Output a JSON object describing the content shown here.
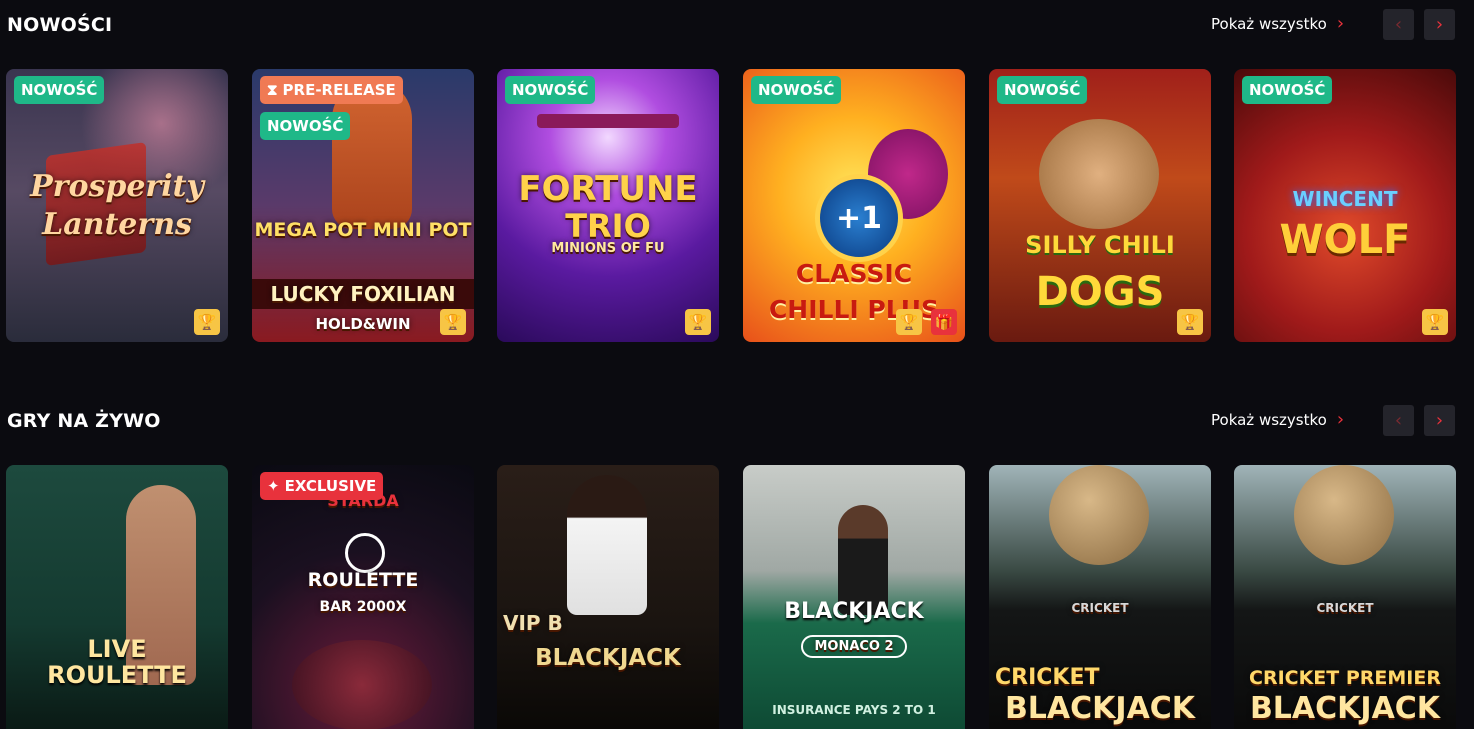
{
  "sections": [
    {
      "title": "NOWOŚCI",
      "show_all": "Pokaż wszystko",
      "tiles": [
        {
          "name": "Prosperity Lanterns",
          "art_lines": [
            "Prosperity",
            "Lanterns"
          ],
          "badges": [
            "NOWOŚĆ"
          ]
        },
        {
          "name": "Lucky Foxilian",
          "art_lines": [
            "MEGA POT   MINI POT",
            "LUCKY FOXILIAN",
            "HOLD&WIN"
          ],
          "badges": [
            "PRE-RELEASE",
            "NOWOŚĆ"
          ]
        },
        {
          "name": "Fortune Trio",
          "art_lines": [
            "FORTUNE",
            "TRIO",
            "MINIONS OF FU"
          ],
          "badges": [
            "NOWOŚĆ"
          ]
        },
        {
          "name": "Classic Chilli Plus",
          "art_lines": [
            "+1",
            "CLASSIC",
            "CHILLI PLUS"
          ],
          "badges": [
            "NOWOŚĆ"
          ]
        },
        {
          "name": "Silly Chili Dogs",
          "art_lines": [
            "SILLY CHILI",
            "DOGS"
          ],
          "badges": [
            "NOWOŚĆ"
          ]
        },
        {
          "name": "Wincent Wolf",
          "art_lines": [
            "WINCENT",
            "WOLF"
          ],
          "badges": [
            "NOWOŚĆ"
          ]
        }
      ]
    },
    {
      "title": "GRY NA ŻYWO",
      "show_all": "Pokaż wszystko",
      "tiles": [
        {
          "name": "Live Roulette",
          "art_lines": [
            "LIVE",
            "ROULETTE"
          ],
          "badges": []
        },
        {
          "name": "Roulette Bar 2000X",
          "art_lines": [
            "STARDA",
            "ROULETTE",
            "BAR 2000X"
          ],
          "badges": [
            "EXCLUSIVE"
          ]
        },
        {
          "name": "VIP B Blackjack",
          "art_lines": [
            "VIP B",
            "BLACKJACK"
          ],
          "badges": []
        },
        {
          "name": "Blackjack Monaco 2",
          "art_lines": [
            "BLACKJACK",
            "MONACO 2",
            "INSURANCE PAYS 2 TO 1"
          ],
          "badges": []
        },
        {
          "name": "Cricket Blackjack",
          "art_lines": [
            "CRICKET",
            "CRICKET",
            "BLACKJACK"
          ],
          "badges": []
        },
        {
          "name": "Cricket Premier Blackjack",
          "art_lines": [
            "CRICKET",
            "CRICKET PREMIER",
            "BLACKJACK"
          ],
          "badges": []
        }
      ]
    }
  ],
  "icons": {
    "trophy": "trophy-icon",
    "gift": "gift-icon",
    "chevron_left": "chevron-left-icon",
    "chevron_right": "chevron-right-icon",
    "hourglass": "hourglass-icon",
    "sparkle": "sparkle-icon"
  },
  "colors": {
    "background": "#0b0b10",
    "accent": "#e8323c",
    "new_badge": "#1fb888",
    "pre_release_badge": "#f07a54",
    "trophy": "#f7c545"
  }
}
